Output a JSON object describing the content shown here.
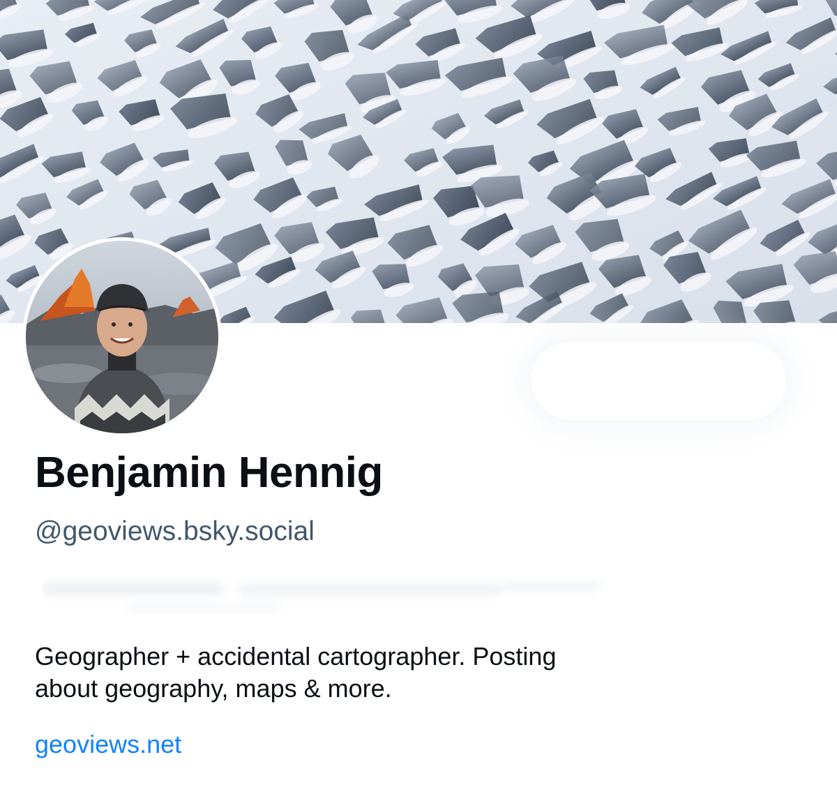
{
  "profile": {
    "display_name": "Benjamin Hennig",
    "handle": "@geoviews.bsky.social",
    "bio_line1": "Geographer + accidental cartographer. Posting",
    "bio_line2": "about geography, maps & more.",
    "link_text": "geoviews.net"
  },
  "colors": {
    "name_text": "#0b0f14",
    "handle_text": "#42576c",
    "link": "#1083fe",
    "background": "#ffffff"
  },
  "icons": {
    "banner": "glacier-snow-banner-image",
    "avatar": "profile-avatar-photo"
  }
}
